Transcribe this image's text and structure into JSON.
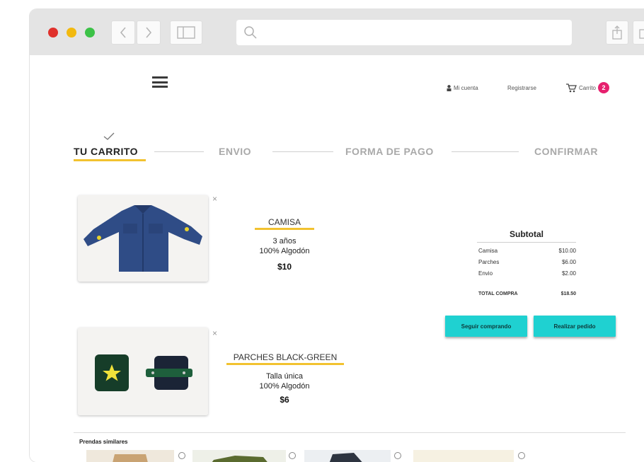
{
  "header": {
    "account_label": "Mi cuenta",
    "register_label": "Registrarse",
    "cart_label": "Carrito",
    "cart_count": "2"
  },
  "steps": [
    {
      "label": "TU CARRITO",
      "active": true
    },
    {
      "label": "ENVIO",
      "active": false
    },
    {
      "label": "FORMA DE PAGO",
      "active": false
    },
    {
      "label": "CONFIRMAR",
      "active": false
    }
  ],
  "cart": {
    "items": [
      {
        "name": "CAMISA",
        "line1": "3 años",
        "line2": "100% Algodón",
        "price": "$10"
      },
      {
        "name": "PARCHES BLACK-GREEN",
        "line1": "Talla única",
        "line2": "100% Algodón",
        "price": "$6"
      }
    ],
    "remove_symbol": "×"
  },
  "subtotal": {
    "title": "Subtotal",
    "rows": [
      {
        "label": "Camisa",
        "value": "$10.00"
      },
      {
        "label": "Parches",
        "value": "$6.00"
      },
      {
        "label": "Envio",
        "value": "$2.00"
      }
    ],
    "total_label": "TOTAL COMPRA",
    "total_value": "$18.50"
  },
  "buttons": {
    "continue_label": "Seguir comprando",
    "order_label": "Realizar pedido"
  },
  "similar": {
    "title": "Prendas similares"
  },
  "colors": {
    "accent_yellow": "#f2c230",
    "button_cyan": "#1fd1d1",
    "badge_pink": "#e6206e"
  }
}
